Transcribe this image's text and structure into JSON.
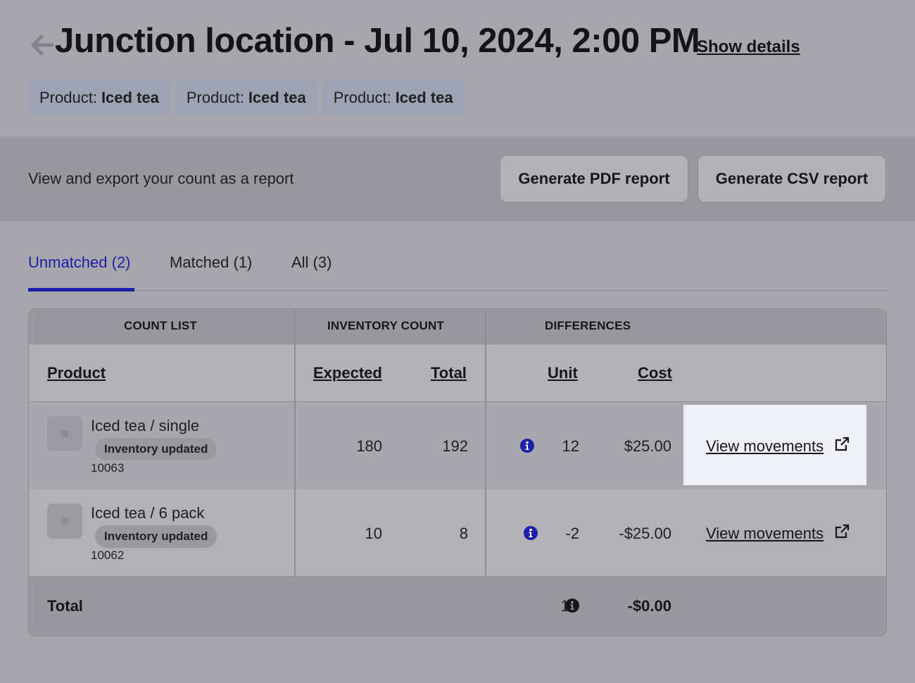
{
  "header": {
    "title": "Junction location - Jul 10, 2024, 2:00 PM",
    "show_details": "Show details"
  },
  "chips": [
    {
      "label": "Product:",
      "value": "Iced tea"
    },
    {
      "label": "Product:",
      "value": "Iced tea"
    },
    {
      "label": "Product:",
      "value": "Iced tea"
    }
  ],
  "export": {
    "text": "View and export your count as a report",
    "pdf_button": "Generate PDF report",
    "csv_button": "Generate CSV report"
  },
  "tabs": [
    {
      "label": "Unmatched (2)",
      "active": true
    },
    {
      "label": "Matched (1)",
      "active": false
    },
    {
      "label": "All (3)",
      "active": false
    }
  ],
  "table": {
    "groups": {
      "count_list": "COUNT LIST",
      "inventory_count": "INVENTORY COUNT",
      "differences": "DIFFERENCES"
    },
    "columns": {
      "product": "Product",
      "expected": "Expected",
      "total": "Total",
      "unit": "Unit",
      "cost": "Cost"
    },
    "rows": [
      {
        "name": "Iced tea / single",
        "badge": "Inventory updated",
        "sku": "10063",
        "expected": "180",
        "total": "192",
        "unit": "12",
        "cost": "$25.00",
        "link": "View movements"
      },
      {
        "name": "Iced tea / 6 pack",
        "badge": "Inventory updated",
        "sku": "10062",
        "expected": "10",
        "total": "8",
        "unit": "-2",
        "cost": "-$25.00",
        "link": "View movements"
      }
    ],
    "totals": {
      "label": "Total",
      "unit": "10",
      "cost": "-$0.00"
    }
  },
  "colors": {
    "accent": "#1d1fa8",
    "background": "#a7a6ac",
    "highlight": "#eff0f6"
  }
}
